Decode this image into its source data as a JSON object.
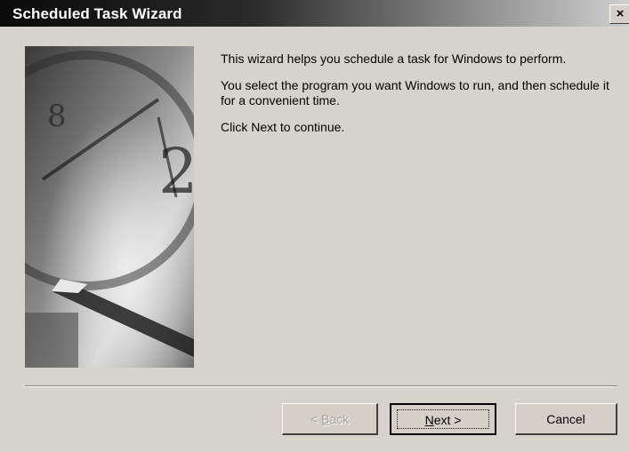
{
  "window": {
    "title": "Scheduled Task Wizard",
    "close_glyph": "×"
  },
  "intro": {
    "line1": "This wizard helps you schedule a task for Windows to perform.",
    "line2": "You select the program you want Windows to run, and then schedule it for a convenient time.",
    "line3": "Click Next to continue."
  },
  "buttons": {
    "back_prefix": "< ",
    "back_mnemonic": "B",
    "back_rest": "ack",
    "next_mnemonic": "N",
    "next_rest": "ext >",
    "cancel": "Cancel"
  },
  "icons": {
    "side_image": "clock-and-pen-illustration"
  }
}
